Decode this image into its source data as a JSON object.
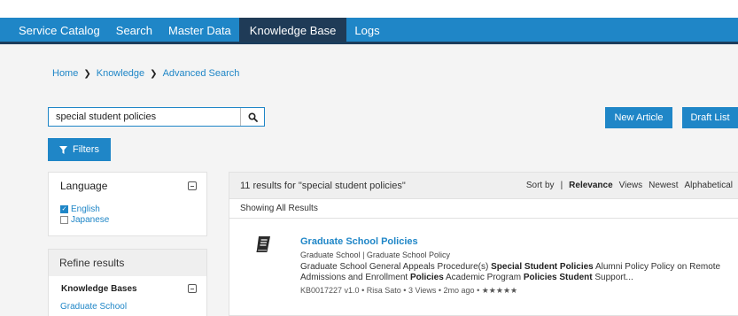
{
  "nav": {
    "items": [
      "Service Catalog",
      "Search",
      "Master Data",
      "Knowledge Base",
      "Logs"
    ],
    "active": "Knowledge Base"
  },
  "breadcrumb": {
    "home": "Home",
    "knowledge": "Knowledge",
    "advanced": "Advanced Search"
  },
  "search": {
    "value": "special student policies"
  },
  "actions": {
    "new_article": "New Article",
    "draft_list": "Draft List",
    "filters": "Filters"
  },
  "language_panel": {
    "title": "Language",
    "options": [
      {
        "label": "English",
        "checked": true
      },
      {
        "label": "Japanese",
        "checked": false
      }
    ]
  },
  "refine": {
    "title": "Refine results",
    "kb_header": "Knowledge Bases",
    "kb_items": [
      "Graduate School"
    ]
  },
  "results": {
    "summary": "11 results for \"special student policies\"",
    "sort_label": "Sort by",
    "sort_sep": "|",
    "sort_options": [
      "Relevance",
      "Views",
      "Newest",
      "Alphabetical"
    ],
    "sort_active": "Relevance",
    "showing": "Showing All Results",
    "articles": [
      {
        "title": "Graduate School Policies",
        "kb": "Graduate School",
        "category": "Graduate School Policy",
        "path_sep": "|",
        "snippet_segments": [
          {
            "text": "Graduate School General Appeals Procedure(s) ",
            "bold": false
          },
          {
            "text": "Special Student Policies",
            "bold": true
          },
          {
            "text": " Alumni Policy Policy on Remote Admissions and Enrollment ",
            "bold": false
          },
          {
            "text": "Policies",
            "bold": true
          },
          {
            "text": " Academic Program ",
            "bold": false
          },
          {
            "text": "Policies Student",
            "bold": true
          },
          {
            "text": " Support...",
            "bold": false
          }
        ],
        "number": "KB0017227 v1.0",
        "author": "Risa Sato",
        "views": "3 Views",
        "age": "2mo ago",
        "rating": "★★★★★",
        "meta_sep": "•"
      }
    ]
  },
  "colors": {
    "primary": "#1f86c7",
    "nav_active": "#1f3b57",
    "nav_border": "#1b3d5c",
    "page_bg": "#f4f4f4"
  },
  "icons": {
    "search": "search-icon",
    "filter": "filter-icon",
    "collapse": "collapse-icon",
    "article": "book-icon",
    "breadcrumb_sep": "chevron-right-icon"
  }
}
